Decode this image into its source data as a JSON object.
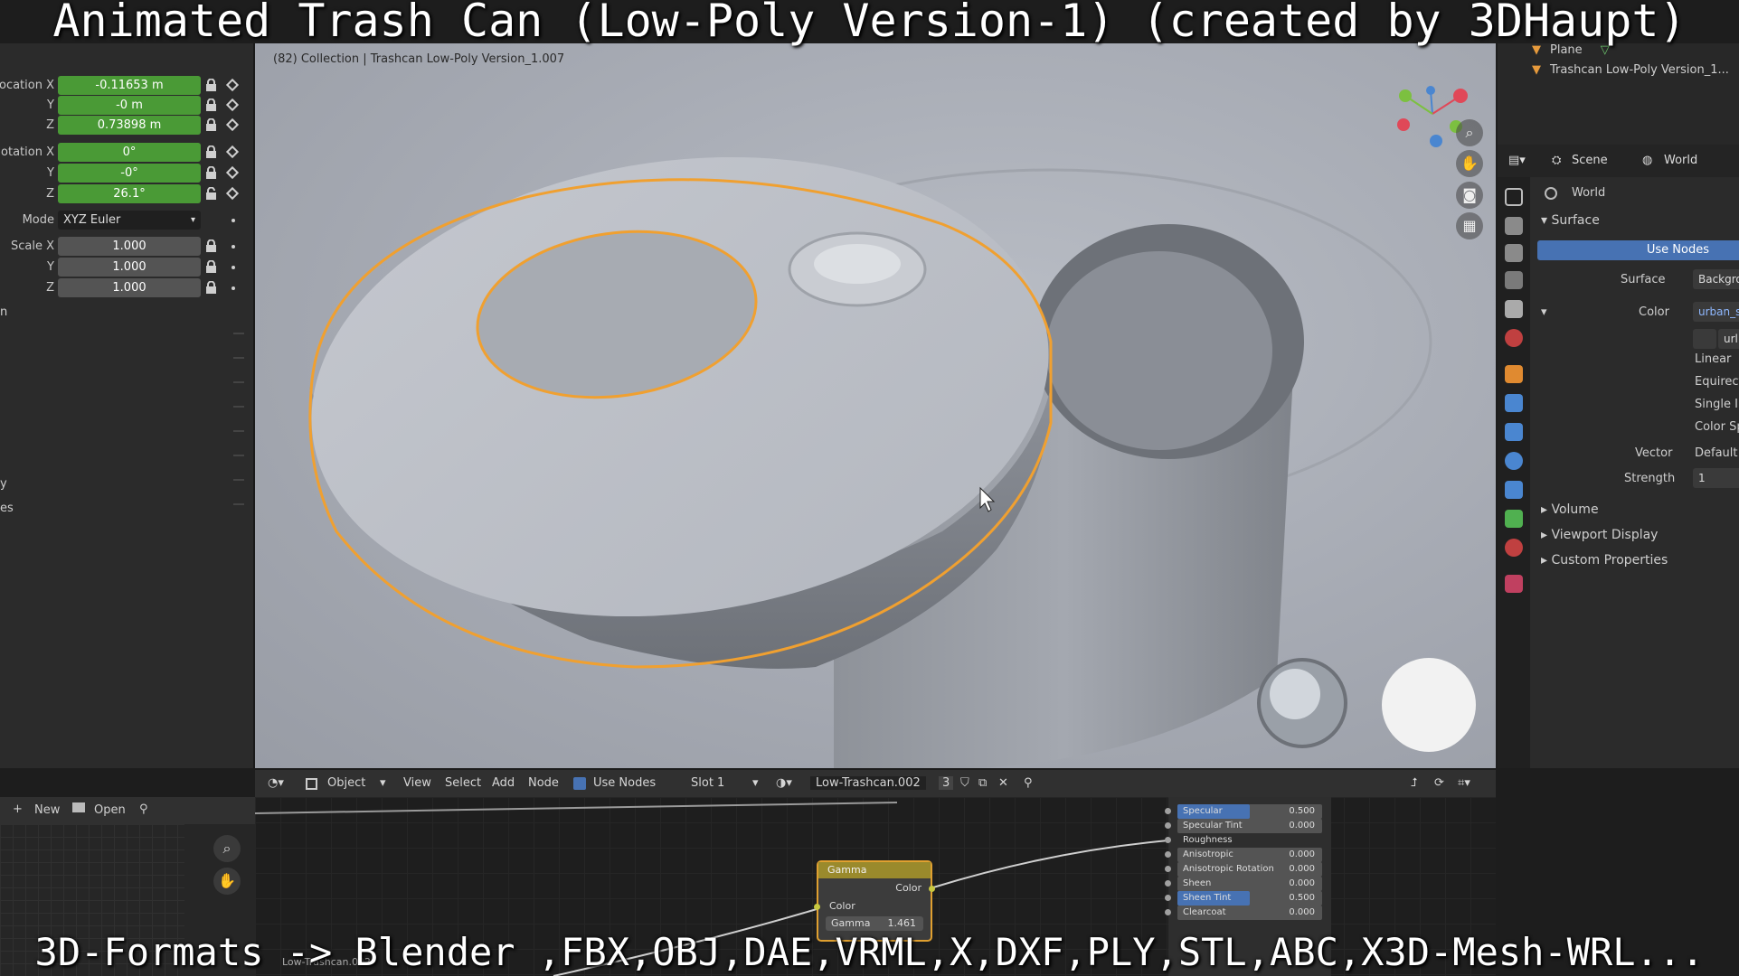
{
  "captions": {
    "top": "Animated Trash Can (Low-Poly Version-1) (created by 3DHaupt)",
    "bottom": "3D-Formats -> Blender ,FBX,OBJ,DAE,VRML,X,DXF,PLY,STL,ABC,X3D-Mesh-WRL..."
  },
  "transform": {
    "location": {
      "label_x": "ocation X",
      "x": "-0.11653 m",
      "label_y": "Y",
      "y": "-0 m",
      "label_z": "Z",
      "z": "0.73898 m"
    },
    "rotation": {
      "label_x": "otation X",
      "x": "0°",
      "label_y": "Y",
      "y": "-0°",
      "label_z": "Z",
      "z": "26.1°"
    },
    "mode": {
      "label": "Mode",
      "value": "XYZ Euler"
    },
    "scale": {
      "label_x": "Scale X",
      "x": "1.000",
      "label_y": "Y",
      "y": "1.000",
      "label_z": "Z",
      "z": "1.000"
    },
    "fragments": [
      "n",
      "y",
      "es"
    ]
  },
  "viewport": {
    "header": "(82) Collection | Trashcan Low-Poly Version_1.007",
    "accent_color": "#f0a030",
    "nav": [
      "zoom-icon",
      "hand-icon",
      "camera-icon",
      "grid-icon"
    ]
  },
  "outliner": {
    "items": [
      "Plane",
      "Trashcan Low-Poly Version_1..."
    ]
  },
  "properties": {
    "context": {
      "scene": "Scene",
      "world": "World"
    },
    "world_name": "World",
    "surface_section": "Surface",
    "use_nodes": "Use Nodes",
    "rows": [
      {
        "label": "Surface",
        "value": "Backgro"
      },
      {
        "label": "Color",
        "value": "urban_s"
      }
    ],
    "image_values": [
      "url",
      "Linear",
      "Equirect",
      "Single Im",
      "Color Sp"
    ],
    "vector": {
      "label": "Vector",
      "value": "Default"
    },
    "strength": {
      "label": "Strength",
      "value": "1"
    },
    "sections": [
      "Volume",
      "Viewport Display",
      "Custom Properties"
    ]
  },
  "node_editor": {
    "mode": "Object",
    "menus": [
      "View",
      "Select",
      "Add",
      "Node"
    ],
    "use_nodes": "Use Nodes",
    "slot": "Slot 1",
    "material": "Low-Trashcan.002",
    "users": "3",
    "gamma_node": {
      "title": "Gamma",
      "out": "Color",
      "in": "Color",
      "gamma_label": "Gamma",
      "gamma_value": "1.461"
    },
    "frame_label": "Low-Trashcan.002",
    "bsdf": [
      {
        "label": "Specular",
        "value": "0.500",
        "fill": 0.5
      },
      {
        "label": "Specular Tint",
        "value": "0.000",
        "fill": 0
      },
      {
        "label": "Roughness",
        "value": "",
        "fill": 0
      },
      {
        "label": "Anisotropic",
        "value": "0.000",
        "fill": 0
      },
      {
        "label": "Anisotropic Rotation",
        "value": "0.000",
        "fill": 0
      },
      {
        "label": "Sheen",
        "value": "0.000",
        "fill": 0
      },
      {
        "label": "Sheen Tint",
        "value": "0.500",
        "fill": 0.5
      },
      {
        "label": "Clearcoat",
        "value": "0.000",
        "fill": 0
      }
    ]
  },
  "image_editor": {
    "new": "New",
    "open": "Open"
  }
}
